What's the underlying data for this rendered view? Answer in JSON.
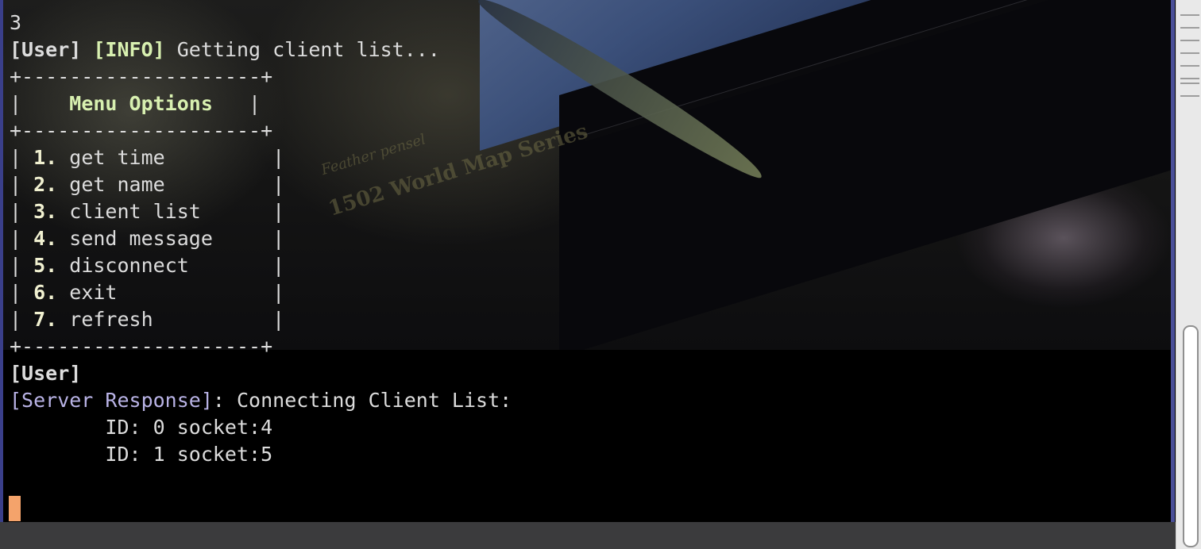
{
  "terminal": {
    "input_echo": "3",
    "info_prefix": "[User]",
    "info_tag": "[INFO]",
    "info_text": "Getting client list...",
    "menu_border": "+--------------------+",
    "menu_title": "Menu Options",
    "menu_items": [
      {
        "number": "1.",
        "label": "get time"
      },
      {
        "number": "2.",
        "label": "get name"
      },
      {
        "number": "3.",
        "label": "client list"
      },
      {
        "number": "4.",
        "label": "send message"
      },
      {
        "number": "5.",
        "label": "disconnect"
      },
      {
        "number": "6.",
        "label": "exit"
      },
      {
        "number": "7.",
        "label": "refresh"
      }
    ],
    "prompt": "[User]",
    "server_prefix": "[Server Response]",
    "server_colon": ":",
    "server_text": "Connecting Client List:",
    "clients": [
      "ID: 0 socket:4",
      "ID: 1 socket:5"
    ]
  },
  "colors": {
    "cursor": "#f4a36b",
    "menu_title": "#d8f0b0",
    "server_prefix": "#b9b3e6",
    "text": "#dcdcdc"
  },
  "wallpaper": {
    "embossed_line_1": "Feather pensel",
    "embossed_line_2": "1502 World Map Series"
  }
}
